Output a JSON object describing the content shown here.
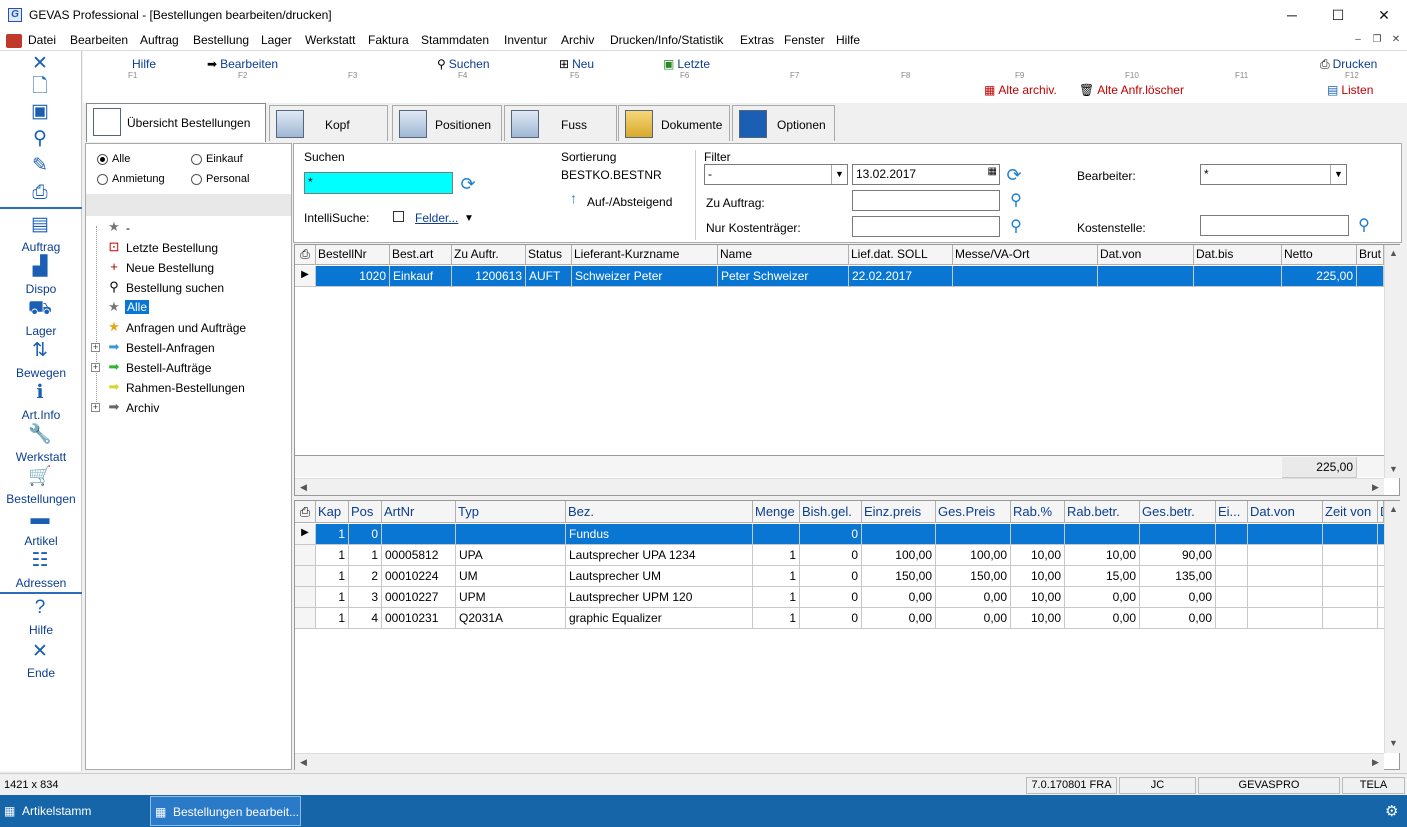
{
  "window": {
    "title": "GEVAS Professional - [Bestellungen bearbeiten/drucken]",
    "minimize": "─",
    "maximize": "☐",
    "close": "✕"
  },
  "menu": [
    "Datei",
    "Bearbeiten",
    "Auftrag",
    "Bestellung",
    "Lager",
    "Werkstatt",
    "Faktura",
    "Stammdaten",
    "Inventur",
    "Archiv",
    "Drucken/Info/Statistik",
    "Extras",
    "Fenster",
    "Hilfe"
  ],
  "leftbar": {
    "nav": [
      "Auftrag",
      "Dispo",
      "Lager",
      "Bewegen",
      "Art.Info",
      "Werkstatt",
      "Bestellungen",
      "Artikel",
      "Adressen"
    ],
    "bottom": [
      "Hilfe",
      "Ende"
    ]
  },
  "toolbar": {
    "fkeys": [
      "F1",
      "F2",
      "F3",
      "F4",
      "F5",
      "F6",
      "F7",
      "F8",
      "F9",
      "F10",
      "F11",
      "F12"
    ],
    "hilfe": "Hilfe",
    "bearbeiten": "Bearbeiten",
    "suchen": "Suchen",
    "neu": "Neu",
    "letzte": "Letzte",
    "drucken": "Drucken",
    "alte_archiv": "Alte archiv.",
    "alte_anfr": "Alte Anfr.löscher",
    "listen": "Listen"
  },
  "tabs": [
    "Übersicht Bestellungen",
    "Kopf",
    "Positionen",
    "Fuss",
    "Dokumente",
    "Optionen"
  ],
  "filter_radios": {
    "alle": "Alle",
    "einkauf": "Einkauf",
    "anmietung": "Anmietung",
    "personal": "Personal"
  },
  "tree": {
    "items": [
      "-",
      "Letzte Bestellung",
      "Neue Bestellung",
      "Bestellung suchen",
      "Alle",
      "Anfragen und Aufträge",
      "Bestell-Anfragen",
      "Bestell-Aufträge",
      "Rahmen-Bestellungen",
      "Archiv"
    ]
  },
  "search": {
    "suchen_label": "Suchen",
    "suchen_value": "*",
    "intellisuche_label": "IntelliSuche:",
    "felder_label": "Felder...",
    "sortierung_label": "Sortierung",
    "sortierung_value": "BESTKO.BESTNR",
    "auf_ab": "Auf-/Absteigend",
    "filter_label": "Filter",
    "filter_value": "-",
    "date_value": "13.02.2017",
    "zu_auftrag_label": "Zu Auftrag:",
    "nur_kosten_label": "Nur Kostenträger:",
    "bearbeiter_label": "Bearbeiter:",
    "bearbeiter_value": "*",
    "kostenstelle_label": "Kostenstelle:"
  },
  "orders": {
    "columns": [
      "BestellNr",
      "Best.art",
      "Zu Auftr.",
      "Status",
      "Lieferant-Kurzname",
      "Name",
      "Lief.dat. SOLL",
      "Messe/VA-Ort",
      "Dat.von",
      "Dat.bis",
      "Netto",
      "Brut"
    ],
    "rows": [
      [
        "1020",
        "Einkauf",
        "1200613",
        "AUFT",
        "Schweizer Peter",
        "Peter Schweizer",
        "22.02.2017",
        "",
        "",
        "",
        "225,00",
        ""
      ]
    ],
    "total": "225,00"
  },
  "positions": {
    "columns": [
      "Kap",
      "Pos",
      "ArtNr",
      "Typ",
      "Bez.",
      "Menge",
      "Bish.gel.",
      "Einz.preis",
      "Ges.Preis",
      "Rab.%",
      "Rab.betr.",
      "Ges.betr.",
      "Ei...",
      "Dat.von",
      "Zeit von",
      "D"
    ],
    "rows": [
      [
        "1",
        "0",
        "",
        "",
        "Fundus",
        "",
        "0",
        "",
        "",
        "",
        "",
        "",
        "",
        "",
        "",
        ""
      ],
      [
        "1",
        "1",
        "00005812",
        "UPA",
        "Lautsprecher UPA 1234",
        "1",
        "0",
        "100,00",
        "100,00",
        "10,00",
        "10,00",
        "90,00",
        "",
        "",
        "",
        ""
      ],
      [
        "1",
        "2",
        "00010224",
        "UM",
        "Lautsprecher UM",
        "1",
        "0",
        "150,00",
        "150,00",
        "10,00",
        "15,00",
        "135,00",
        "",
        "",
        "",
        ""
      ],
      [
        "1",
        "3",
        "00010227",
        "UPM",
        "Lautsprecher UPM 120",
        "1",
        "0",
        "0,00",
        "0,00",
        "10,00",
        "0,00",
        "0,00",
        "",
        "",
        "",
        ""
      ],
      [
        "1",
        "4",
        "00010231",
        "Q2031A",
        "graphic Equalizer",
        "1",
        "0",
        "0,00",
        "0,00",
        "10,00",
        "0,00",
        "0,00",
        "",
        "",
        "",
        ""
      ]
    ]
  },
  "status": {
    "size": "1421 x 834",
    "version": "7.0.170801 FRA",
    "user": "JC",
    "db": "GEVASPRO",
    "site": "TELA"
  },
  "taskbar": {
    "item1": "Artikelstamm",
    "item2": "Bestellungen bearbeit..."
  }
}
